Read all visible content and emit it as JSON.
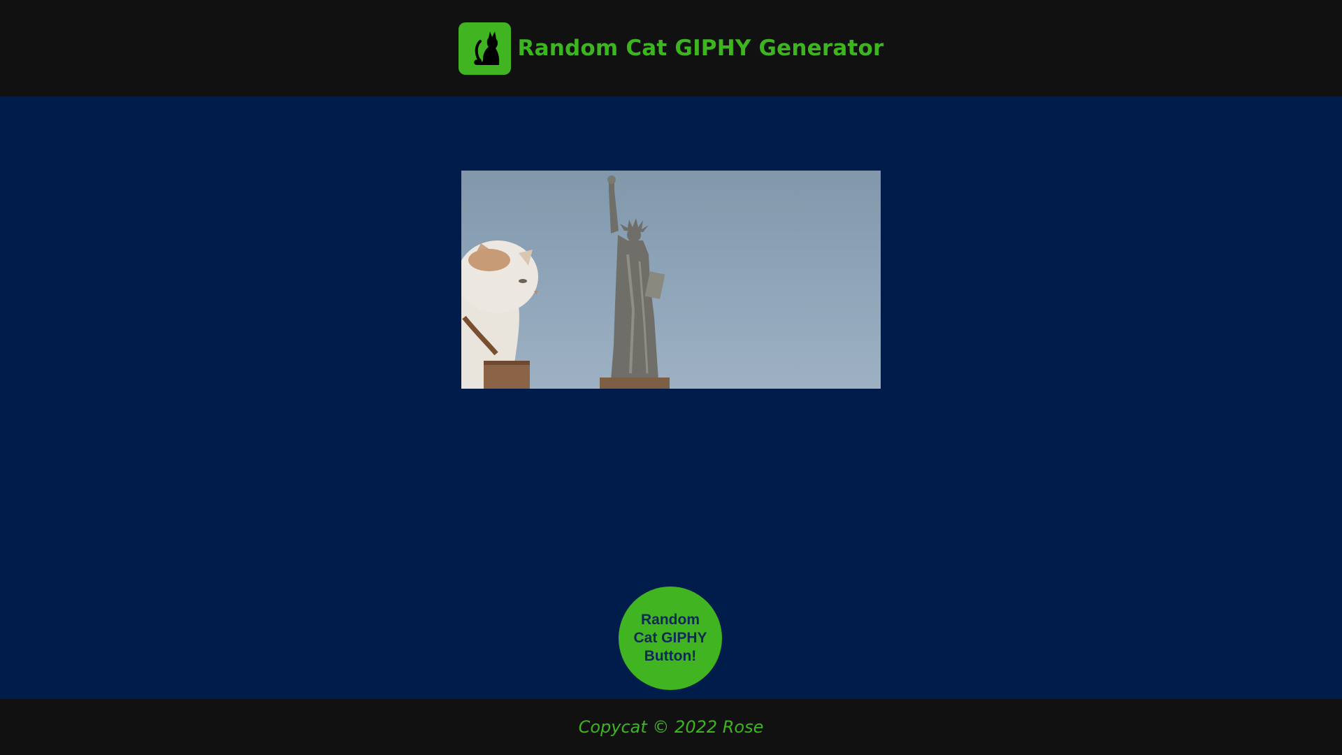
{
  "header": {
    "logo_icon": "cat-silhouette-icon",
    "title": "Random Cat GIPHY Generator"
  },
  "gif": {
    "description_icon": "cat-gif-image"
  },
  "button": {
    "label": "Random Cat GIPHY Button!"
  },
  "footer": {
    "text": "Copycat © 2022 Rose"
  },
  "colors": {
    "accent": "#40b521",
    "background": "#001c4a",
    "bars": "#111111",
    "button_text": "#0c2a55"
  }
}
